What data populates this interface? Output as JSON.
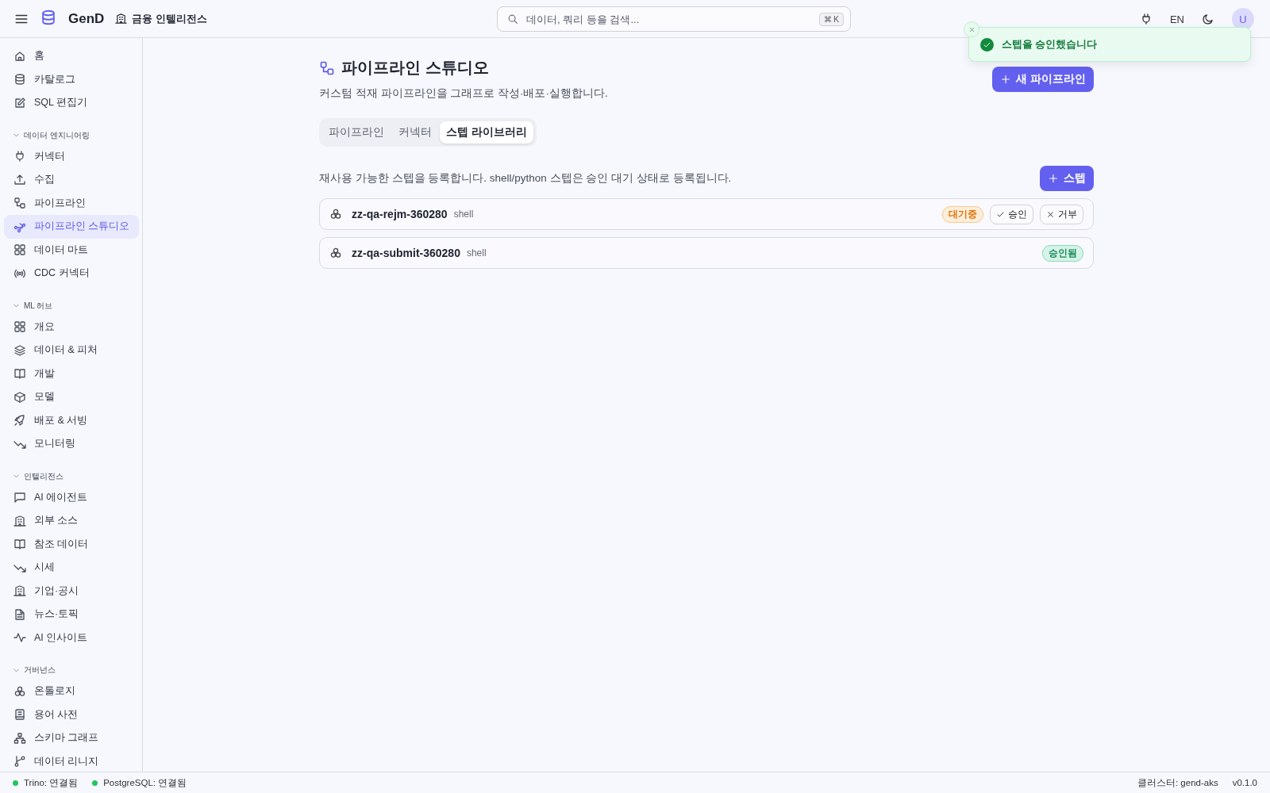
{
  "header": {
    "brand": "GenD",
    "workspace": "금융 인텔리전스",
    "search": {
      "placeholder": "데이터, 쿼리 등을 검색...",
      "shortcut": "⌘ K"
    },
    "language": "EN",
    "avatar": "U"
  },
  "sidebar": {
    "groups": [
      {
        "items": [
          {
            "label": "홈",
            "selected": false
          },
          {
            "label": "카탈로그",
            "selected": false
          },
          {
            "label": "SQL 편집기",
            "selected": false
          }
        ]
      },
      {
        "title": "데이터 엔지니어링",
        "expanded": true,
        "items": [
          {
            "label": "커넥터",
            "selected": false
          },
          {
            "label": "수집",
            "selected": false
          },
          {
            "label": "파이프라인",
            "selected": false
          },
          {
            "label": "파이프라인 스튜디오",
            "selected": true
          },
          {
            "label": "데이터 마트",
            "selected": false
          },
          {
            "label": "CDC 커넥터",
            "selected": false
          }
        ]
      },
      {
        "title": "ML 허브",
        "expanded": true,
        "items": [
          {
            "label": "개요",
            "selected": false
          },
          {
            "label": "데이터 & 피처",
            "selected": false
          },
          {
            "label": "개발",
            "selected": false
          },
          {
            "label": "모델",
            "selected": false
          },
          {
            "label": "배포 & 서빙",
            "selected": false
          },
          {
            "label": "모니터링",
            "selected": false
          }
        ]
      },
      {
        "title": "인텔리전스",
        "expanded": true,
        "items": [
          {
            "label": "AI 에이전트",
            "selected": false
          },
          {
            "label": "외부 소스",
            "selected": false
          },
          {
            "label": "참조 데이터",
            "selected": false
          },
          {
            "label": "시세",
            "selected": false
          },
          {
            "label": "기업·공시",
            "selected": false
          },
          {
            "label": "뉴스·토픽",
            "selected": false
          },
          {
            "label": "AI 인사이트",
            "selected": false
          }
        ]
      },
      {
        "title": "거버넌스",
        "expanded": true,
        "items": [
          {
            "label": "온톨로지",
            "selected": false
          },
          {
            "label": "용어 사전",
            "selected": false
          },
          {
            "label": "스키마 그래프",
            "selected": false
          },
          {
            "label": "데이터 리니지",
            "selected": false
          }
        ]
      }
    ]
  },
  "page": {
    "title": "파이프라인 스튜디오",
    "subtitle": "커스텀 적재 파이프라인을 그래프로 작성·배포·실행합니다.",
    "new_button": "새 파이프라인",
    "tabs": [
      {
        "label": "파이프라인",
        "selected": false
      },
      {
        "label": "커넥터",
        "selected": false
      },
      {
        "label": "스텝 라이브러리",
        "selected": true
      }
    ],
    "description": "재사용 가능한 스텝을 등록합니다. shell/python 스텝은 승인 대기 상태로 등록됩니다.",
    "add_button": "스텝",
    "steps": [
      {
        "name": "zz-qa-rejm-360280",
        "type": "shell",
        "status": "대기중",
        "kind": "pending",
        "actions": [
          {
            "label": "승인",
            "kind": "approve"
          },
          {
            "label": "거부",
            "kind": "reject"
          }
        ]
      },
      {
        "name": "zz-qa-submit-360280",
        "type": "shell",
        "status": "승인됨",
        "kind": "approved"
      }
    ]
  },
  "toast": {
    "message": "스텝을 승인했습니다"
  },
  "status_bar": {
    "connections": [
      {
        "label": "Trino: 연결됨",
        "color": "#22c55e"
      },
      {
        "label": "PostgreSQL: 연결됨",
        "color": "#22c55e"
      }
    ],
    "cluster": "클러스터: gend-aks",
    "version": "v0.1.0"
  }
}
